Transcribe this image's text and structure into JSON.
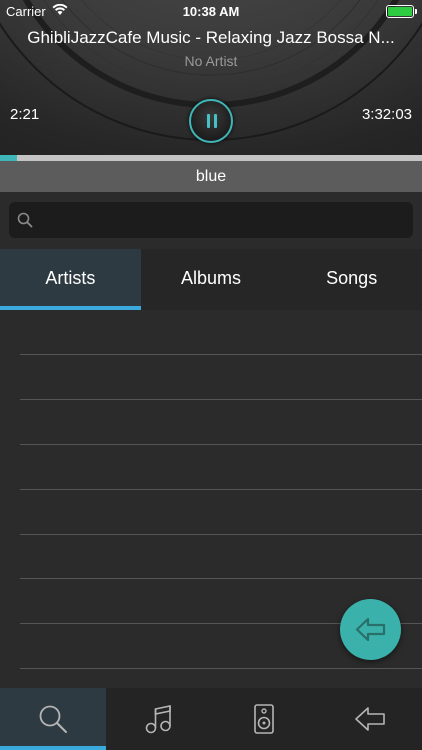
{
  "status_bar": {
    "carrier": "Carrier",
    "time": "10:38 AM"
  },
  "player": {
    "track_title": "GhibliJazzCafe Music - Relaxing Jazz  Bossa N...",
    "artist": "No Artist",
    "elapsed": "2:21",
    "duration": "3:32:03",
    "progress_fraction": 0.04,
    "state_icon": "pause-icon"
  },
  "playlist": {
    "name": "blue"
  },
  "search": {
    "placeholder": "",
    "value": ""
  },
  "tabs": [
    {
      "label": "Artists",
      "active": true
    },
    {
      "label": "Albums",
      "active": false
    },
    {
      "label": "Songs",
      "active": false
    }
  ],
  "list": {
    "rows": [
      "",
      "",
      "",
      "",
      "",
      "",
      "",
      ""
    ]
  },
  "fab": {
    "icon": "back-arrow-icon"
  },
  "tab_bar": {
    "items": [
      {
        "icon": "search-icon",
        "active": true
      },
      {
        "icon": "music-note-icon",
        "active": false
      },
      {
        "icon": "speaker-icon",
        "active": false
      },
      {
        "icon": "back-arrow-icon",
        "active": false
      }
    ]
  },
  "colors": {
    "accent": "#3fb6b8",
    "tab_indicator": "#3aa9de",
    "fab": "#3ab2ab",
    "battery": "#2ecc40"
  }
}
